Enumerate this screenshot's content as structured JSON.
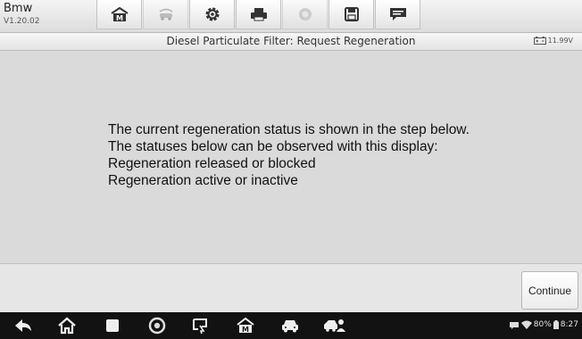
{
  "app": {
    "name": "Bmw",
    "version": "V1.20.02"
  },
  "toolbar": {
    "buttons": [
      {
        "icon": "home-icon",
        "enabled": true
      },
      {
        "icon": "vehicle-swap-icon",
        "enabled": false
      },
      {
        "icon": "settings-icon",
        "enabled": true
      },
      {
        "icon": "print-icon",
        "enabled": true
      },
      {
        "icon": "help-icon",
        "enabled": false
      },
      {
        "icon": "save-icon",
        "enabled": true
      },
      {
        "icon": "data-logging-icon",
        "enabled": true
      }
    ]
  },
  "header": {
    "title": "Diesel Particulate Filter: Request Regeneration",
    "battery_voltage": "11.99V"
  },
  "message": {
    "lines": [
      "The current regeneration status is shown in the step below.",
      "The statuses below can be observed with this display:",
      "Regeneration released or blocked",
      "Regeneration active or inactive"
    ]
  },
  "footer": {
    "continue_label": "Continue"
  },
  "navbar": {
    "icons": [
      "back-icon",
      "home-nav-icon",
      "recent-apps-icon",
      "chrome-icon",
      "remote-desktop-icon",
      "maxisys-home-icon",
      "vehicle-icon",
      "shop-manager-icon"
    ],
    "status": {
      "battery": "80%",
      "time": "8:27"
    }
  }
}
